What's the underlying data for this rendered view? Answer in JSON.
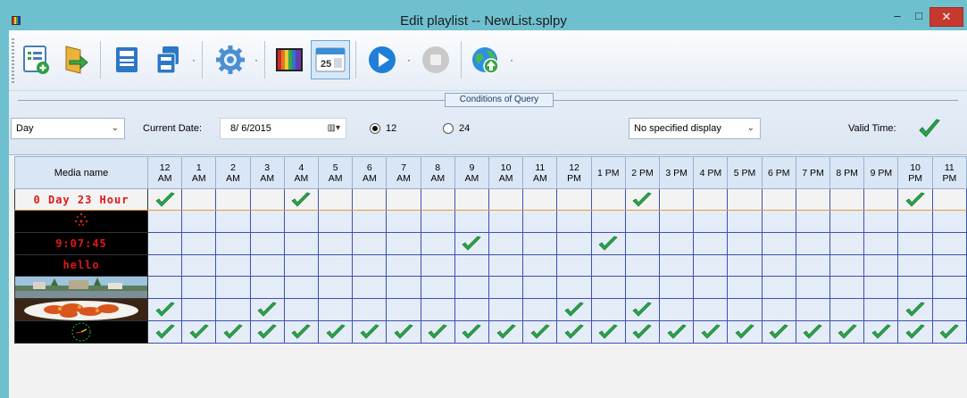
{
  "window": {
    "title": "Edit playlist  --  NewList.splpy",
    "minimize": "–",
    "maximize": "□",
    "close": "✕"
  },
  "toolbar": {
    "buttons": [
      {
        "name": "add-item",
        "icon": "list-add-icon"
      },
      {
        "name": "import",
        "icon": "import-arrow-icon"
      },
      {
        "name": "save",
        "icon": "save-icon"
      },
      {
        "name": "save-as",
        "icon": "save-as-icon"
      },
      {
        "name": "settings",
        "icon": "gear-icon",
        "dropdown": true
      },
      {
        "name": "color",
        "icon": "color-bars-icon"
      },
      {
        "name": "calendar",
        "icon": "calendar-icon",
        "active": true,
        "calendar_day": "25"
      },
      {
        "name": "play",
        "icon": "play-icon",
        "dropdown": true
      },
      {
        "name": "stop",
        "icon": "stop-icon"
      },
      {
        "name": "publish",
        "icon": "globe-upload-icon",
        "dropdown": true
      }
    ],
    "dropdown_glyph": "·"
  },
  "query": {
    "caption": "Conditions of Query",
    "period": "Day",
    "current_date_label": "Current Date:",
    "current_date": "8/ 6/2015",
    "radio_12_label": "12",
    "radio_24_label": "24",
    "selected_mode": "12",
    "display": "No specified display",
    "valid_time_label": "Valid Time:",
    "valid_time": true
  },
  "grid": {
    "media_header": "Media name",
    "columns": [
      [
        "12",
        "AM"
      ],
      [
        "1",
        "AM"
      ],
      [
        "2",
        "AM"
      ],
      [
        "3",
        "AM"
      ],
      [
        "4",
        "AM"
      ],
      [
        "5",
        "AM"
      ],
      [
        "6",
        "AM"
      ],
      [
        "7",
        "AM"
      ],
      [
        "8",
        "AM"
      ],
      [
        "9",
        "AM"
      ],
      [
        "10",
        "AM"
      ],
      [
        "11",
        "AM"
      ],
      [
        "12",
        "PM"
      ],
      [
        "1 PM",
        ""
      ],
      [
        "2 PM",
        ""
      ],
      [
        "3 PM",
        ""
      ],
      [
        "4 PM",
        ""
      ],
      [
        "5 PM",
        ""
      ],
      [
        "6 PM",
        ""
      ],
      [
        "7 PM",
        ""
      ],
      [
        "8 PM",
        ""
      ],
      [
        "9 PM",
        ""
      ],
      [
        "10",
        "PM"
      ],
      [
        "11",
        "PM"
      ]
    ],
    "rows": [
      {
        "media": "0 Day 23 Hour",
        "kind": "led",
        "selected": true,
        "checks": [
          0,
          4,
          14,
          22
        ]
      },
      {
        "media": "",
        "kind": "clock-dots",
        "selected": false,
        "checks": []
      },
      {
        "media": "9:07:45",
        "kind": "led",
        "selected": false,
        "checks": [
          9,
          13
        ]
      },
      {
        "media": "hello",
        "kind": "led",
        "selected": false,
        "checks": []
      },
      {
        "media": "",
        "kind": "photo-harbor",
        "selected": false,
        "checks": []
      },
      {
        "media": "",
        "kind": "photo-food",
        "selected": false,
        "checks": [
          0,
          3,
          12,
          14,
          22
        ]
      },
      {
        "media": "",
        "kind": "analog-clock",
        "selected": false,
        "checks": [
          0,
          1,
          2,
          3,
          4,
          5,
          6,
          7,
          8,
          9,
          10,
          11,
          12,
          13,
          14,
          15,
          16,
          17,
          18,
          19,
          20,
          21,
          22,
          23
        ]
      }
    ]
  }
}
